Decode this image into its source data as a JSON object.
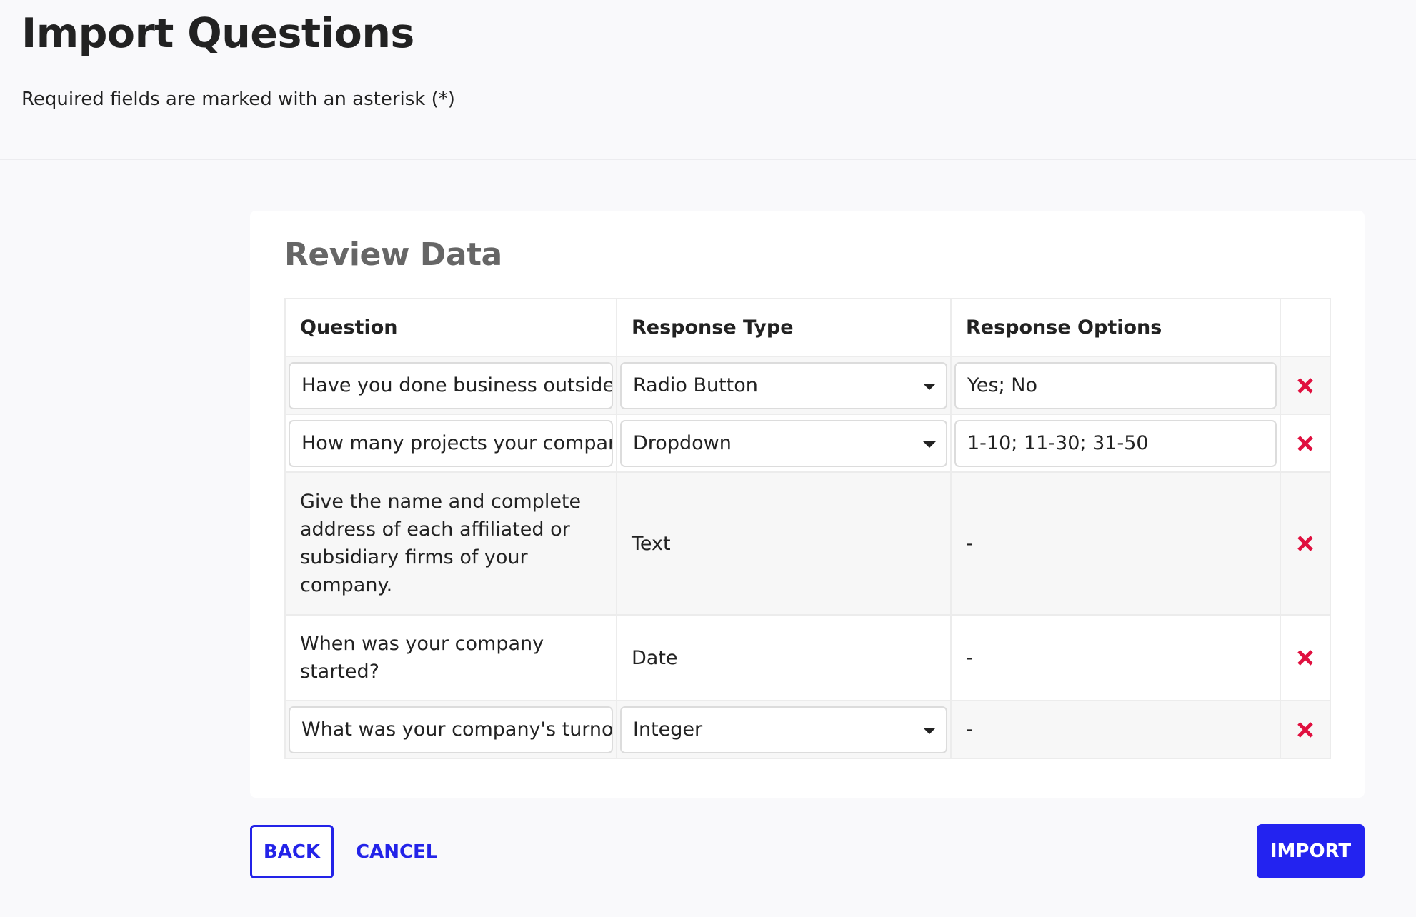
{
  "header": {
    "title": "Import Questions",
    "subtitle": "Required fields are marked with an asterisk (*)"
  },
  "card": {
    "title": "Review Data",
    "columns": [
      "Question",
      "Response Type",
      "Response Options",
      ""
    ],
    "rows": [
      {
        "question": "Have you done business outside the country?",
        "question_editable": true,
        "response_type": "Radio Button",
        "response_type_editable": true,
        "response_options": "Yes; No",
        "response_options_editable": true
      },
      {
        "question": "How many projects your company has completed?",
        "question_editable": true,
        "response_type": "Dropdown",
        "response_type_editable": true,
        "response_options": "1-10; 11-30; 31-50",
        "response_options_editable": true
      },
      {
        "question": "Give the name and complete address of each affiliated or subsidiary firms of your company.",
        "question_editable": false,
        "response_type": "Text",
        "response_type_editable": false,
        "response_options": "-",
        "response_options_editable": false
      },
      {
        "question": "When was your company started?",
        "question_editable": false,
        "response_type": "Date",
        "response_type_editable": false,
        "response_options": "-",
        "response_options_editable": false
      },
      {
        "question": "What was your company's turnover last year?",
        "question_editable": true,
        "response_type": "Integer",
        "response_type_editable": true,
        "response_options": "-",
        "response_options_editable": false
      }
    ],
    "delete_icon": "close-x-icon"
  },
  "footer": {
    "back_label": "BACK",
    "cancel_label": "CANCEL",
    "import_label": "IMPORT"
  },
  "colors": {
    "primary": "#2323f0",
    "delete": "#e0103f",
    "card_title": "#666666",
    "stripe": "#f7f7f7"
  }
}
